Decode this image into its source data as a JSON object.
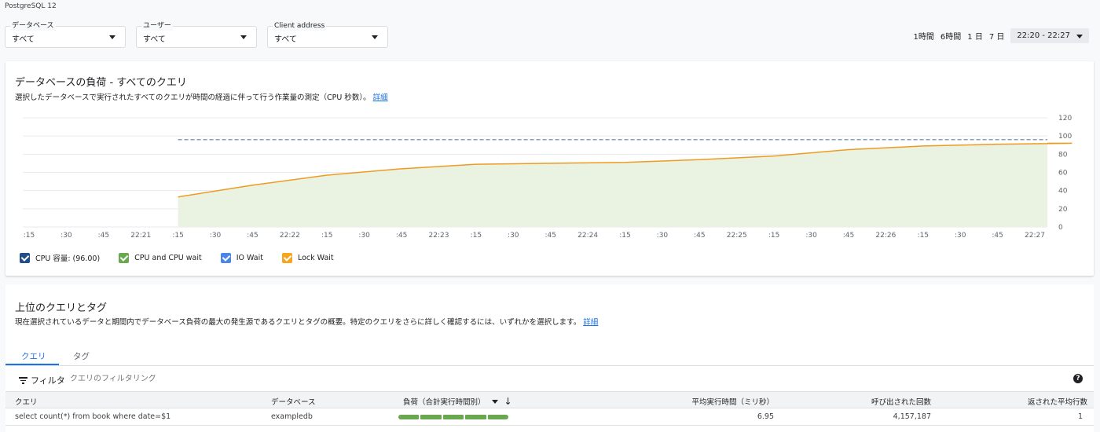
{
  "engine": "PostgreSQL 12",
  "filters": [
    {
      "label": "データベース",
      "value": "すべて"
    },
    {
      "label": "ユーザー",
      "value": "すべて"
    },
    {
      "label": "Client address",
      "value": "すべて"
    }
  ],
  "time_ranges": [
    "1時間",
    "6時間",
    "1 日",
    "7 日"
  ],
  "time_selected": "22:20 - 22:27",
  "load_card": {
    "title": "データベースの負荷 - すべてのクエリ",
    "description": "選択したデータベースで実行されたすべてのクエリが時間の経過に伴って行う作業量の測定（CPU 秒数）。",
    "link": "詳細"
  },
  "chart_data": {
    "type": "area",
    "x_tick_labels": [
      ":15",
      ":30",
      ":45",
      "22:21",
      ":15",
      ":30",
      ":45",
      "22:22",
      ":15",
      ":30",
      ":45",
      "22:23",
      ":15",
      ":30",
      ":45",
      "22:24",
      ":15",
      ":30",
      ":45",
      "22:25",
      ":15",
      ":30",
      ":45",
      "22:26",
      ":15",
      ":30",
      ":45",
      "22:27"
    ],
    "ylim": [
      0,
      120
    ],
    "y_ticks": [
      0,
      20,
      40,
      60,
      80,
      100,
      120
    ],
    "cpu_capacity": 96,
    "series": [
      {
        "name": "Lock Wait",
        "x": [
          "22:21:15",
          "22:21:45",
          "22:22:15",
          "22:22:45",
          "22:23:15",
          "22:23:45",
          "22:24:15",
          "22:24:45",
          "22:25:15",
          "22:25:45",
          "22:26:15",
          "22:26:45",
          "22:27:15"
        ],
        "values": [
          33,
          46,
          57,
          64,
          69,
          70,
          71,
          74,
          78,
          85,
          89,
          91,
          92
        ]
      }
    ],
    "colors": {
      "capacity": "#5f7fa8",
      "line": "#ef9b20",
      "fill": "#eaf2e2",
      "grid": "#e8eaed"
    },
    "grid": true
  },
  "legend": [
    {
      "label": "CPU 容量: (96.00)",
      "color": "#1f4e8a"
    },
    {
      "label": "CPU and CPU wait",
      "color": "#6aa84f"
    },
    {
      "label": "IO Wait",
      "color": "#4a86e8"
    },
    {
      "label": "Lock Wait",
      "color": "#f6a51c"
    }
  ],
  "top_queries": {
    "title": "上位のクエリとタグ",
    "description": "現在選択されているデータと期間内でデータベース負荷の最大の発生源であるクエリとタグの概要。特定のクエリをさらに詳しく確認するには、いずれかを選択します。",
    "link": "詳細",
    "tabs": [
      "クエリ",
      "タグ"
    ],
    "filter_label": "フィルタ",
    "filter_placeholder": "クエリのフィルタリング",
    "columns": [
      "クエリ",
      "データベース",
      "負荷（合計実行時間別）",
      "平均実行時間（ミリ秒）",
      "呼び出された回数",
      "返された平均行数"
    ],
    "rows": [
      {
        "query": "select count(*) from book where date=$1",
        "database": "exampledb",
        "load_fraction": 1,
        "avg_time": "6.95",
        "calls": "4,157,187",
        "avg_rows": "1"
      }
    ]
  }
}
